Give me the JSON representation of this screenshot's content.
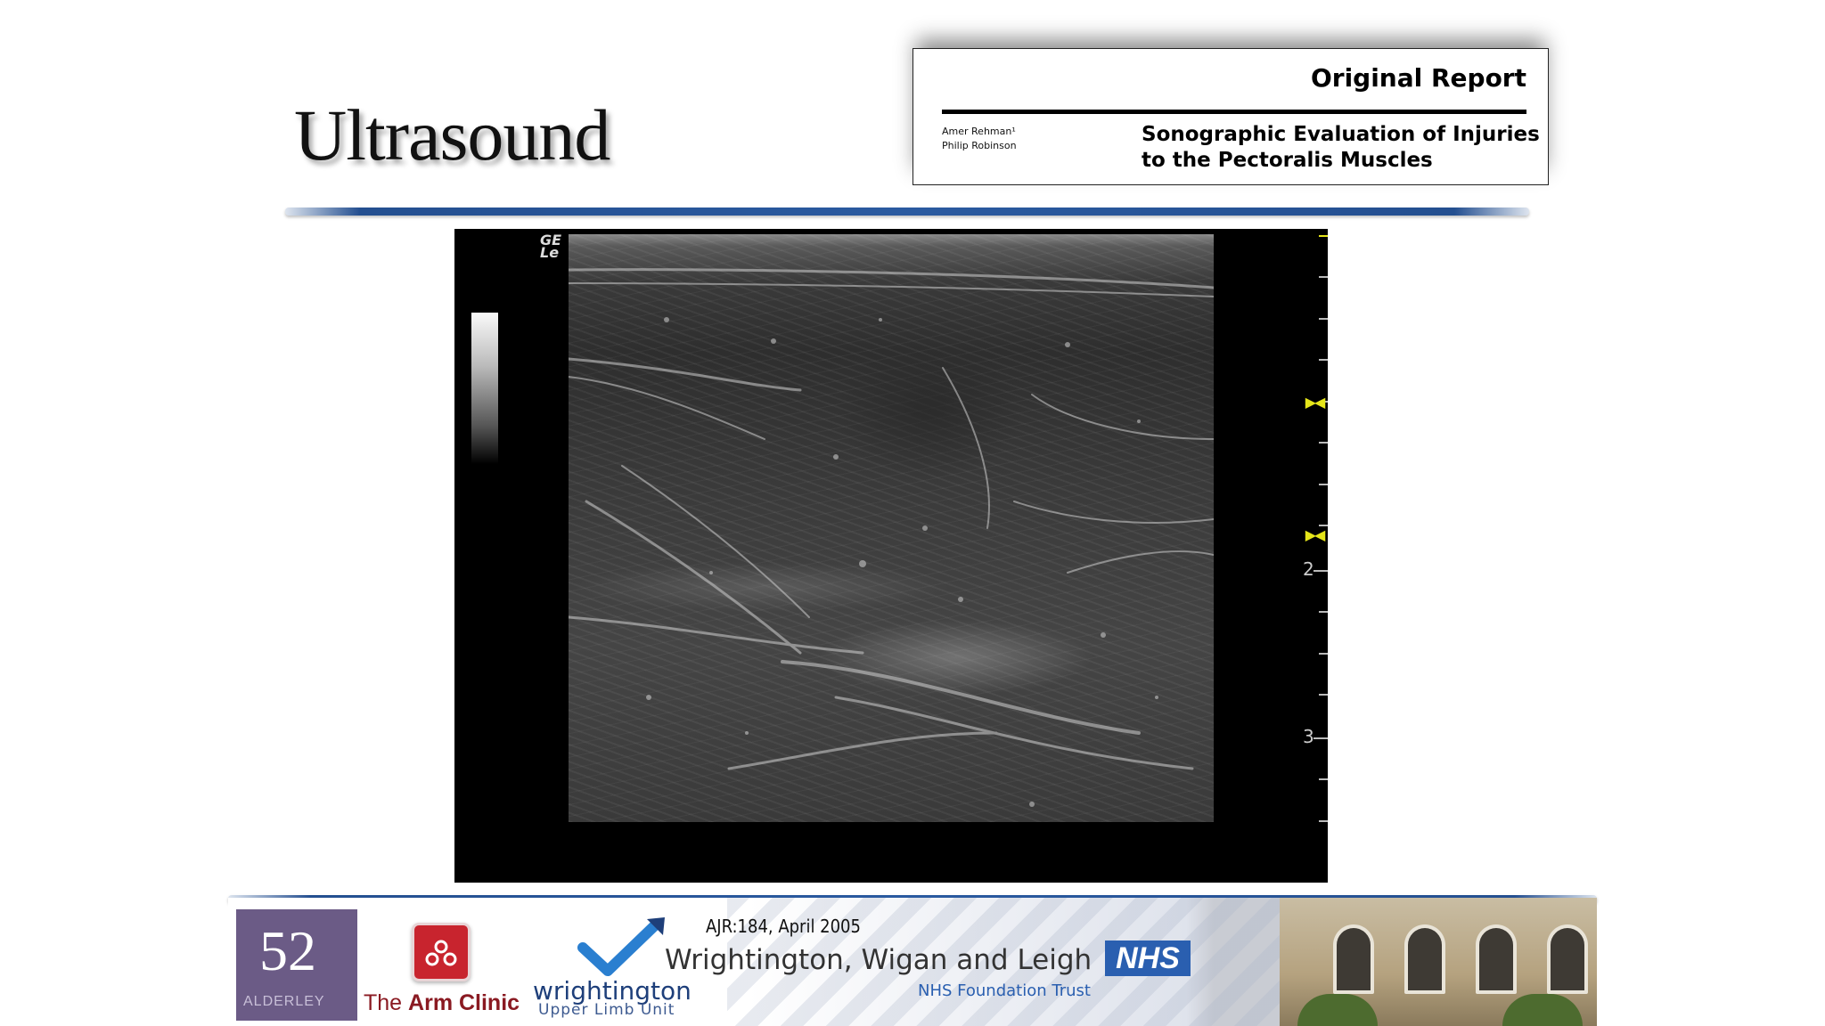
{
  "slide": {
    "title": "Ultrasound"
  },
  "report": {
    "heading": "Original Report",
    "authors": [
      "Amer Rehman¹",
      "Philip Robinson"
    ],
    "article_title_line1": "Sonographic Evaluation of Injuries",
    "article_title_line2": "to the Pectoralis Muscles"
  },
  "ultrasound": {
    "logo": [
      "GE",
      "Le"
    ],
    "depth_labels": [
      "2",
      "3"
    ],
    "focus_markers": 2
  },
  "footer": {
    "alderley_number": "52",
    "alderley_name": "ALDERLEY",
    "arm_clinic_prefix": "The ",
    "arm_clinic_name": "Arm Clinic",
    "wrightington_name": "wrightington",
    "wrightington_unit": "Upper Limb Unit",
    "citation": "AJR:184, April 2005",
    "trust_name": "Wrightington, Wigan and Leigh",
    "nhs_logo": "NHS",
    "trust_sub": "NHS Foundation Trust"
  },
  "colors": {
    "rule_blue": "#2a5aa0",
    "alderley_purple": "#6b5b86",
    "arm_clinic_red": "#c8242e",
    "nhs_blue": "#2a5fb0",
    "focus_yellow": "#e6e61a"
  }
}
